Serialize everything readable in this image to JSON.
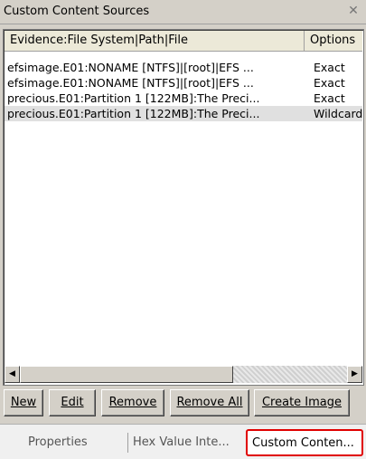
{
  "window": {
    "title": "Custom Content Sources"
  },
  "list": {
    "columns": [
      "Evidence:File System|Path|File",
      "Options"
    ],
    "rows": [
      {
        "path": "efsimage.E01:NONAME [NTFS]|[root]|EFS ...",
        "option": "Exact"
      },
      {
        "path": "efsimage.E01:NONAME [NTFS]|[root]|EFS ...",
        "option": "Exact"
      },
      {
        "path": "precious.E01:Partition 1 [122MB]:The Preci...",
        "option": "Exact"
      },
      {
        "path": "precious.E01:Partition 1 [122MB]:The Preci...",
        "option": "Wildcard"
      }
    ]
  },
  "buttons": {
    "new": "New",
    "edit": "Edit",
    "remove": "Remove",
    "remove_all": "Remove All",
    "create_image": "Create Image"
  },
  "tabs": [
    "Properties",
    "Hex Value Inte...",
    "Custom Conten..."
  ],
  "icons": {
    "close": "close-icon",
    "left": "arrow-left-icon",
    "right": "arrow-right-icon"
  }
}
